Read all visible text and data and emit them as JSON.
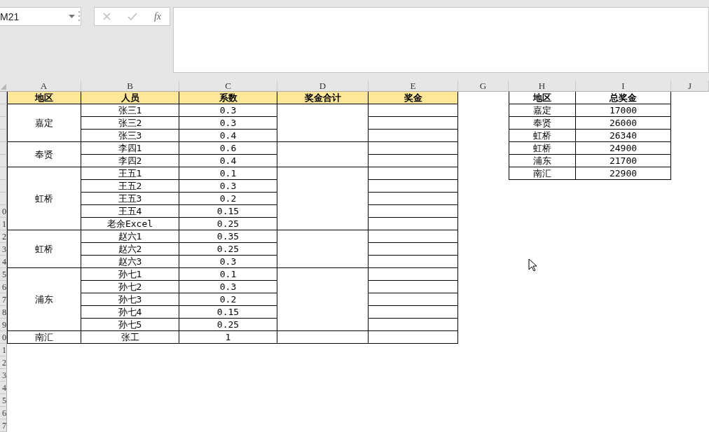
{
  "name_box": {
    "value": "M21"
  },
  "function_button": {
    "label": "fx"
  },
  "columns": [
    "A",
    "B",
    "C",
    "D",
    "E",
    "G",
    "H",
    "I",
    "J"
  ],
  "row_header_digits": [
    "0",
    "1",
    "2",
    "3",
    "4",
    "5",
    "6",
    "7",
    "8",
    "9",
    "0",
    "1",
    "2",
    "3",
    "4",
    "5",
    "6",
    "7"
  ],
  "bonus_table": {
    "columns": [
      "地区",
      "人员",
      "系数",
      "奖金合计",
      "奖金"
    ],
    "groups": [
      {
        "region": "嘉定",
        "people": [
          {
            "name": "张三1",
            "coef": "0.3"
          },
          {
            "name": "张三2",
            "coef": "0.3"
          },
          {
            "name": "张三3",
            "coef": "0.4"
          }
        ]
      },
      {
        "region": "奉贤",
        "people": [
          {
            "name": "李四1",
            "coef": "0.6"
          },
          {
            "name": "李四2",
            "coef": "0.4"
          }
        ]
      },
      {
        "region": "虹桥",
        "people": [
          {
            "name": "王五1",
            "coef": "0.1"
          },
          {
            "name": "王五2",
            "coef": "0.3"
          },
          {
            "name": "王五3",
            "coef": "0.2"
          },
          {
            "name": "王五4",
            "coef": "0.15"
          },
          {
            "name": "老余Excel",
            "coef": "0.25"
          }
        ]
      },
      {
        "region": "虹桥",
        "people": [
          {
            "name": "赵六1",
            "coef": "0.35"
          },
          {
            "name": "赵六2",
            "coef": "0.25"
          },
          {
            "name": "赵六3",
            "coef": "0.3"
          }
        ]
      },
      {
        "region": "浦东",
        "people": [
          {
            "name": "孙七1",
            "coef": "0.1"
          },
          {
            "name": "孙七2",
            "coef": "0.3"
          },
          {
            "name": "孙七3",
            "coef": "0.2"
          },
          {
            "name": "孙七4",
            "coef": "0.15"
          },
          {
            "name": "孙七5",
            "coef": "0.25"
          }
        ]
      },
      {
        "region": "南汇",
        "people": [
          {
            "name": "张工",
            "coef": "1"
          }
        ]
      }
    ]
  },
  "total_table": {
    "columns": [
      "地区",
      "总奖金"
    ],
    "rows": [
      {
        "region": "嘉定",
        "total": "17000"
      },
      {
        "region": "奉贤",
        "total": "26000"
      },
      {
        "region": "虹桥",
        "total": "26340"
      },
      {
        "region": "虹桥",
        "total": "24900"
      },
      {
        "region": "浦东",
        "total": "21700"
      },
      {
        "region": "南汇",
        "total": "22900"
      }
    ]
  }
}
